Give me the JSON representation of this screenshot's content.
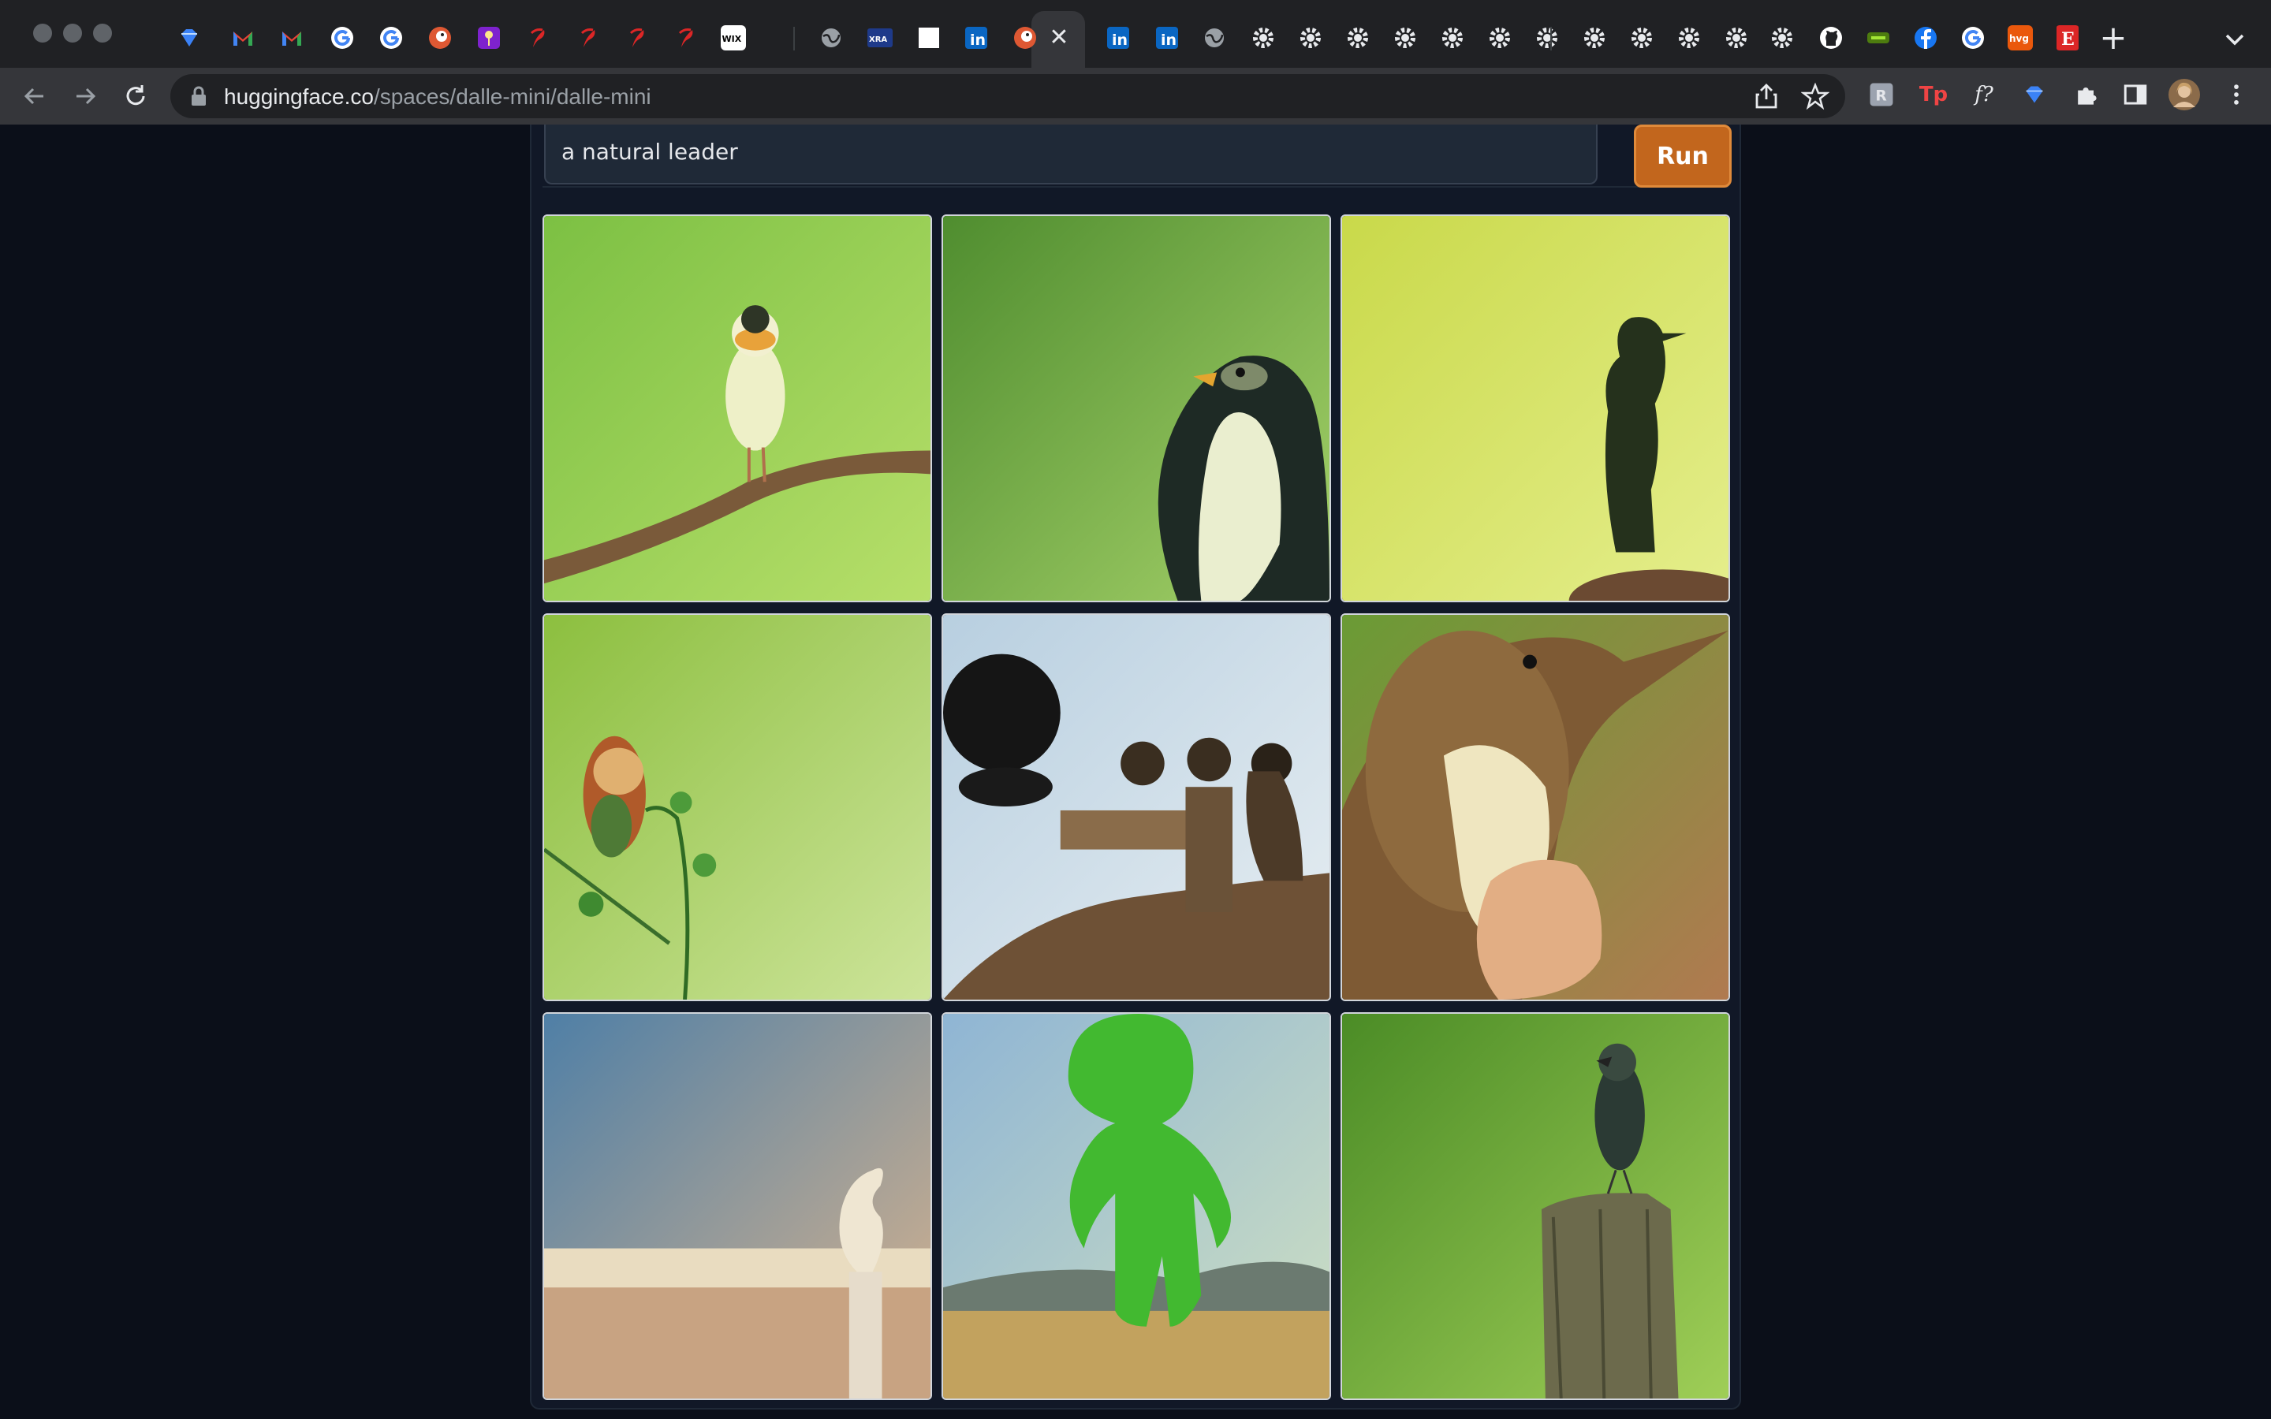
{
  "browser": {
    "tabs": [
      {
        "icon": "sketch-diamond-icon",
        "color": "#3b82f6"
      },
      {
        "icon": "gmail-icon",
        "color": "#ea4335"
      },
      {
        "icon": "gmail-icon",
        "color": "#ea4335"
      },
      {
        "icon": "google-icon",
        "color": "#4285f4"
      },
      {
        "icon": "google-icon",
        "color": "#4285f4"
      },
      {
        "icon": "duckduckgo-icon",
        "color": "#de5833"
      },
      {
        "icon": "purple-app-icon",
        "color": "#7e22ce"
      },
      {
        "icon": "red-feather-icon",
        "color": "#dc2626"
      },
      {
        "icon": "red-feather-icon",
        "color": "#dc2626"
      },
      {
        "icon": "red-feather-icon",
        "color": "#dc2626"
      },
      {
        "icon": "red-feather-icon",
        "color": "#dc2626"
      },
      {
        "icon": "wix-icon",
        "label": "WIX",
        "color": "#ffffff"
      },
      {
        "icon": "globe-icon",
        "color": "#9aa0a6"
      },
      {
        "icon": "xra-icon",
        "label": "XRA",
        "color": "#1e3a8a"
      },
      {
        "icon": "blank-page-icon",
        "color": "#ffffff"
      },
      {
        "icon": "linkedin-icon",
        "label": "in",
        "color": "#0a66c2"
      },
      {
        "icon": "huggingface-icon",
        "color": "#de5833"
      },
      {
        "icon": "linkedin-icon",
        "label": "in",
        "color": "#0a66c2"
      },
      {
        "icon": "linkedin-icon",
        "label": "in",
        "color": "#0a66c2"
      },
      {
        "icon": "globe-icon",
        "color": "#9aa0a6"
      },
      {
        "icon": "gear-icon",
        "color": "#e8eaed"
      },
      {
        "icon": "gear-icon",
        "color": "#e8eaed"
      },
      {
        "icon": "gear-icon",
        "color": "#e8eaed"
      },
      {
        "icon": "gear-icon",
        "color": "#e8eaed"
      },
      {
        "icon": "gear-icon",
        "color": "#e8eaed"
      },
      {
        "icon": "gear-icon",
        "color": "#e8eaed"
      },
      {
        "icon": "gear-icon",
        "color": "#e8eaed"
      },
      {
        "icon": "gear-icon",
        "color": "#e8eaed"
      },
      {
        "icon": "gear-icon",
        "color": "#e8eaed"
      },
      {
        "icon": "gear-icon",
        "color": "#e8eaed"
      },
      {
        "icon": "gear-icon",
        "color": "#e8eaed"
      },
      {
        "icon": "gear-icon",
        "color": "#e8eaed"
      },
      {
        "icon": "github-icon",
        "color": "#ffffff"
      },
      {
        "icon": "green-badge-icon",
        "color": "#4d7c0f"
      },
      {
        "icon": "facebook-icon",
        "color": "#1877f2"
      },
      {
        "icon": "google-icon",
        "color": "#4285f4"
      },
      {
        "icon": "hvg-icon",
        "label": "hvg",
        "color": "#ea580c"
      },
      {
        "icon": "etsy-icon",
        "label": "E",
        "color": "#dc2626"
      }
    ],
    "url_host": "huggingface.co",
    "url_path": "/spaces/dalle-mini/dalle-mini",
    "extensions": [
      {
        "icon": "readwise-icon",
        "label": "R",
        "color": "#9ca3af"
      },
      {
        "icon": "tp-icon",
        "label": "Tp",
        "color": "#ef4444"
      },
      {
        "icon": "font-query-icon",
        "label": "f?",
        "color": "#e8eaed"
      },
      {
        "icon": "sketch-diamond-icon",
        "label": "",
        "color": "#3b82f6"
      }
    ]
  },
  "app": {
    "prompt_value": "a natural leader",
    "run_label": "Run",
    "results": [
      {
        "subject": "small yellow bird on branch",
        "palette": [
          "#7cc043",
          "#b7df6a"
        ]
      },
      {
        "subject": "dark bird head closeup",
        "palette": [
          "#4f8d2f",
          "#a6d26a"
        ]
      },
      {
        "subject": "silhouette with beak on yellow",
        "palette": [
          "#c9d94a",
          "#e5ee8c"
        ]
      },
      {
        "subject": "small bird on stem",
        "palette": [
          "#8cbf3f",
          "#cde49a"
        ]
      },
      {
        "subject": "black birds on perch",
        "palette": [
          "#b8cfe0",
          "#e7eef2"
        ]
      },
      {
        "subject": "kingfisher on hand",
        "palette": [
          "#6a9b35",
          "#b07a50"
        ]
      },
      {
        "subject": "white figure on sky",
        "palette": [
          "#4f7fa6",
          "#d9b48e"
        ]
      },
      {
        "subject": "green figurine",
        "palette": [
          "#8fb5d4",
          "#cfe0c2"
        ]
      },
      {
        "subject": "bird on stump",
        "palette": [
          "#4b8c26",
          "#9fce57"
        ]
      }
    ]
  }
}
